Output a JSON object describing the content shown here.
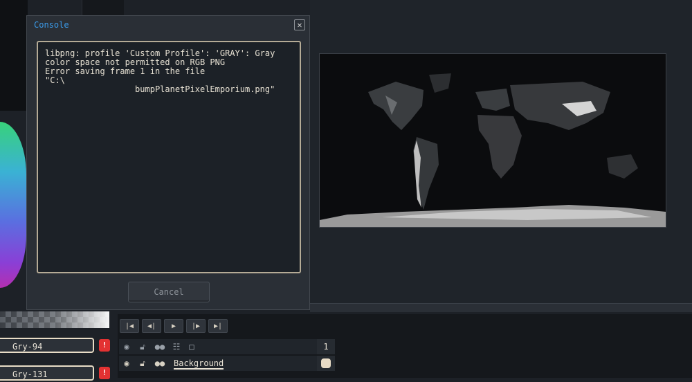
{
  "console": {
    "title": "Console",
    "close_symbol": "✕",
    "message": "libpng: profile 'Custom Profile': 'GRAY': Gray\ncolor space not permitted on RGB PNG\nError saving frame 1 in the file\n\"C:\\\n                  bumpPlanetPixelEmporium.png\"",
    "cancel_label": "Cancel"
  },
  "palette": {
    "items": [
      {
        "label": "Gry-94"
      },
      {
        "label": "Gry-131"
      }
    ],
    "lock_symbol": "!"
  },
  "timeline": {
    "controls": [
      {
        "name": "first-frame-button",
        "symbol": "|◀"
      },
      {
        "name": "prev-frame-button",
        "symbol": "◀|"
      },
      {
        "name": "play-button",
        "symbol": "▶"
      },
      {
        "name": "next-frame-button",
        "symbol": "|▶"
      },
      {
        "name": "last-frame-button",
        "symbol": "▶|"
      }
    ],
    "frame_number": "1",
    "layer_name": "Background"
  },
  "colors": {
    "accent": "#3b9ae8",
    "swatch_border": "#e8dcc6",
    "lock_red": "#e33232"
  }
}
